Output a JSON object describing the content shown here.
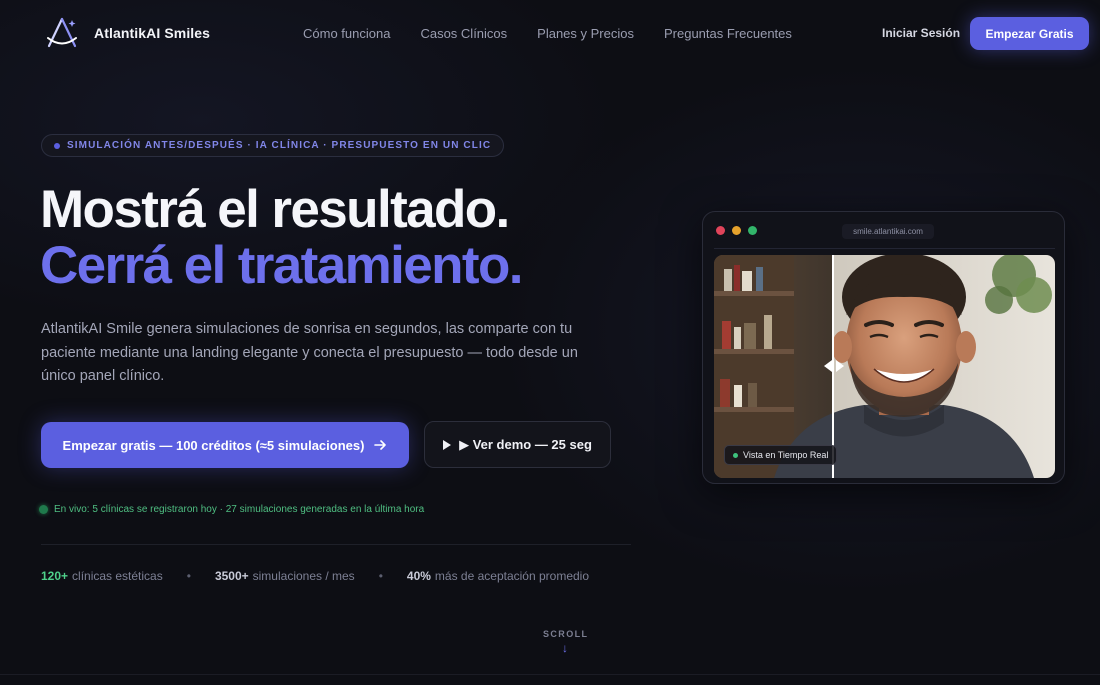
{
  "nav": {
    "brand": "AtlantikAI Smiles",
    "links": [
      "Cómo funciona",
      "Casos Clínicos",
      "Planes y Precios",
      "Preguntas Frecuentes"
    ],
    "login": "Iniciar Sesión",
    "cta": "Empezar Gratis"
  },
  "hero": {
    "badge": "SIMULACIÓN ANTES/DESPUÉS · IA CLÍNICA · PRESUPUESTO EN UN CLIC",
    "headline_line1": "Mostrá el resultado.",
    "headline_line2": "Cerrá el tratamiento.",
    "description": "AtlantikAI Smile genera simulaciones de sonrisa en segundos, las comparte con tu paciente mediante una landing elegante y conecta el presupuesto — todo desde un único panel clínico.",
    "primary_button": "Empezar gratis — 100 créditos (≈5 simulaciones)",
    "secondary_button": "▶ Ver demo — 25 seg",
    "live_text": "En vivo: 5 clínicas se registraron hoy · 27 simulaciones generadas en la última hora"
  },
  "stats": [
    {
      "value": "120+",
      "label": "clínicas estéticas",
      "color": "#4fd08a"
    },
    {
      "value": "3500+",
      "label": "simulaciones / mes",
      "color": "#c9cbd8"
    },
    {
      "value": "40%",
      "label": "más de aceptación promedio",
      "color": "#c9cbd8"
    }
  ],
  "stat_separator": "•",
  "scroll_label": "SCROLL",
  "preview": {
    "url": "smile.atlantikai.com",
    "live_label": "Vista en Tiempo Real",
    "traffic_colors": [
      "#e0445a",
      "#e6a22c",
      "#32b56a"
    ]
  },
  "colors": {
    "accent": "#5b5fe0",
    "headline_accent": "#6d70ec",
    "background": "#0d0e14",
    "live_green": "#4fbf82"
  }
}
